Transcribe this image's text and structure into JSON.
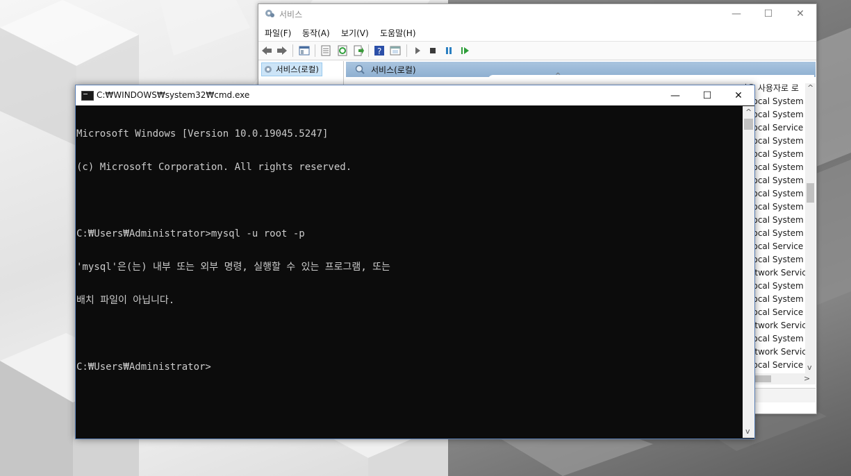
{
  "services_window": {
    "title": "서비스",
    "menu": [
      "파일(F)",
      "동작(A)",
      "보기(V)",
      "도움말(H)"
    ],
    "toolbar_icons": [
      "back-icon",
      "forward-icon",
      "show-hide-tree-icon",
      "export-list-icon",
      "refresh-icon",
      "export-icon",
      "help-icon",
      "console-icon",
      "start-service-icon",
      "stop-service-icon",
      "pause-service-icon",
      "restart-service-icon"
    ],
    "tree_item": "서비스(로컬)",
    "pane_header": "서비스(로컬)",
    "column_header_visible": "다음 사용자로 로",
    "logon_as": [
      "Local System",
      "Local System",
      "Local Service",
      "Local System",
      "Local System",
      "Local System",
      "Local System",
      "Local System",
      "Local System",
      "Local System",
      "Local System",
      "Local Service",
      "Local System",
      "Network Service",
      "Local System",
      "Local System",
      "Local Service",
      "Network Service",
      "Local System",
      "Network Service",
      "Local Service"
    ]
  },
  "cmd_window": {
    "title": "C:₩WINDOWS₩system32₩cmd.exe",
    "lines": [
      "Microsoft Windows [Version 10.0.19045.5247]",
      "(c) Microsoft Corporation. All rights reserved.",
      "",
      "C:₩Users₩Administrator>mysql -u root -p",
      "'mysql'은(는) 내부 또는 외부 명령, 실행할 수 있는 프로그램, 또는",
      "배치 파일이 아닙니다.",
      "",
      "C:₩Users₩Administrator>"
    ]
  },
  "colors": {
    "console_bg": "#0c0c0c",
    "console_text": "#cccccc",
    "pane_header": "#9fbcd9",
    "selection": "#cce4f7"
  }
}
